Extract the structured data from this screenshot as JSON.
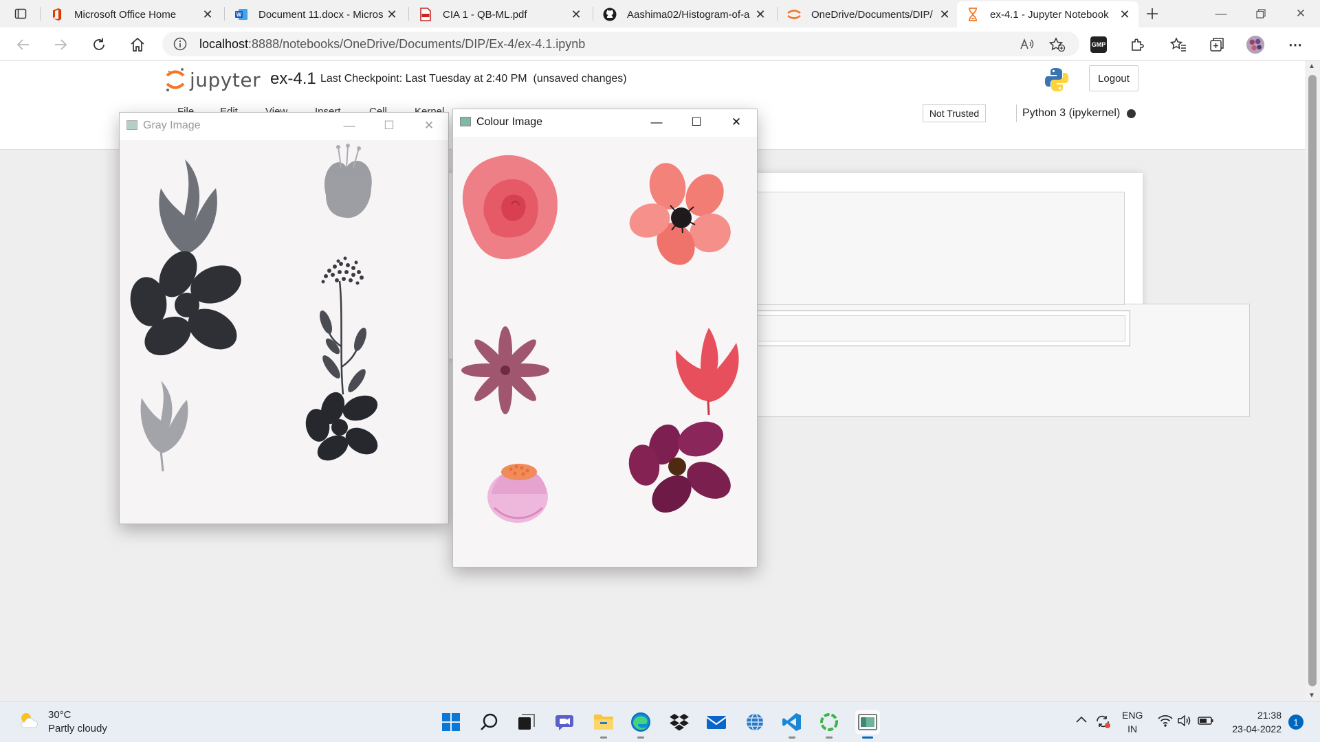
{
  "browser": {
    "tabs": [
      {
        "title": "Microsoft Office Home",
        "icon": "office-icon",
        "active": false
      },
      {
        "title": "Document 11.docx - Micros",
        "icon": "word-icon",
        "active": false
      },
      {
        "title": "CIA 1 - QB-ML.pdf",
        "icon": "pdf-icon",
        "active": false
      },
      {
        "title": "Aashima02/Histogram-of-a",
        "icon": "github-icon",
        "active": false
      },
      {
        "title": "OneDrive/Documents/DIP/",
        "icon": "jupyter-icon",
        "active": false
      },
      {
        "title": "ex-4.1 - Jupyter Notebook",
        "icon": "hourglass-icon",
        "active": true
      }
    ],
    "url_host": "localhost",
    "url_path": ":8888/notebooks/OneDrive/Documents/DIP/Ex-4/ex-4.1.ipynb",
    "extension_label": "GMP"
  },
  "jupyter": {
    "logo_text": "jupyter",
    "notebook_name": "ex-4.1",
    "checkpoint": "Last Checkpoint: Last Tuesday at 2:40 PM",
    "status": "(unsaved changes)",
    "logout": "Logout",
    "menu": [
      "File",
      "Edit",
      "View",
      "Insert",
      "Cell",
      "Kernel"
    ],
    "trusted": "Not Trusted",
    "kernel": "Python 3 (ipykernel)"
  },
  "windows": {
    "gray": {
      "title": "Gray Image"
    },
    "colour": {
      "title": "Colour Image"
    }
  },
  "taskbar": {
    "temperature": "30°C",
    "weather": "Partly cloudy",
    "lang_1": "ENG",
    "lang_2": "IN",
    "time": "21:38",
    "date": "23-04-2022",
    "notifications": "1"
  },
  "colors": {
    "accent": "#0067c0",
    "jupyter_orange": "#f37726",
    "rose": "#e84f5c",
    "plum": "#7a1f4e",
    "mauve": "#a05a78",
    "pink": "#e9a9cf"
  }
}
